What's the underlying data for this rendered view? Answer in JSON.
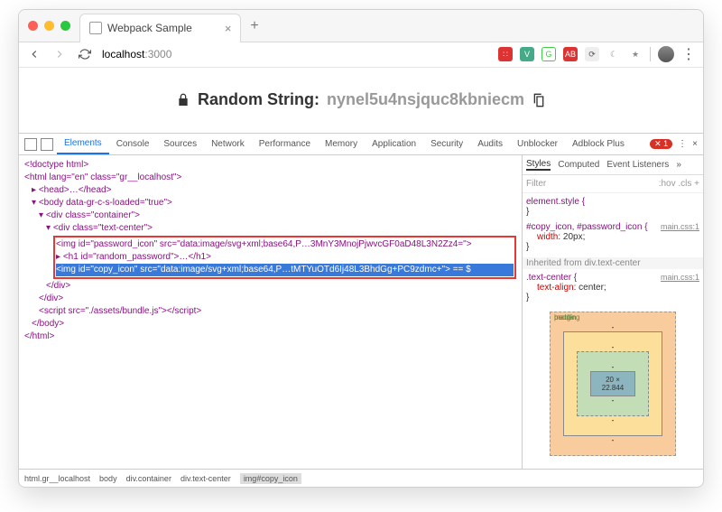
{
  "browser": {
    "tab_title": "Webpack Sample",
    "url_host": "localhost",
    "url_port": ":3000"
  },
  "page": {
    "heading_label": "Random String:",
    "heading_value": "nynel5u4nsjquc8kbniecm"
  },
  "devtools": {
    "tabs": [
      "Elements",
      "Console",
      "Sources",
      "Network",
      "Performance",
      "Memory",
      "Application",
      "Security",
      "Audits",
      "Unblocker",
      "Adblock Plus"
    ],
    "error_count": "1",
    "dom": {
      "l1": "<!doctype html>",
      "l2": "<html lang=\"en\" class=\"gr__localhost\">",
      "l3": "<head>…</head>",
      "l4": "<body data-gr-c-s-loaded=\"true\">",
      "l5": "<div class=\"container\">",
      "l6": "<div class=\"text-center\">",
      "l7": "<img id=\"password_icon\" src=\"data:image/svg+xml;base64,P…3MnY3MnojPjwvcGF0aD48L3N2Zz4=\">",
      "l8": "<h1 id=\"random_password\">…</h1>",
      "l9": "<img id=\"copy_icon\" src=\"data:image/svg+xml;base64,P…tMTYuOTd6Ij48L3BhdGg+PC9zdmc+\"> == $",
      "l10": "</div>",
      "l11": "</div>",
      "l12": "<script src=\"./assets/bundle.js\"></scr",
      "l12b": "ipt>",
      "l13": "</body>",
      "l14": "</html>"
    },
    "styles": {
      "tabs": [
        "Styles",
        "Computed",
        "Event Listeners"
      ],
      "filter": "Filter",
      "hov": ":hov",
      "cls": ".cls",
      "rule1_sel": "element.style {",
      "rule1_close": "}",
      "rule2_sel": "#copy_icon, #password_icon {",
      "rule2_src": "main.css:1",
      "rule2_prop": "width",
      "rule2_val": ": 20px;",
      "rule2_close": "}",
      "inherited": "Inherited from div.text-center",
      "rule3_sel": ".text-center {",
      "rule3_src": "main.css:1",
      "rule3_prop": "text-align",
      "rule3_val": ": center;",
      "rule3_close": "}",
      "box_dims": "20 × 22.844",
      "margin_lbl": "margin",
      "border_lbl": "border",
      "padding_lbl": "padding"
    },
    "breadcrumb": [
      "html.gr__localhost",
      "body",
      "div.container",
      "div.text-center",
      "img#copy_icon"
    ]
  }
}
